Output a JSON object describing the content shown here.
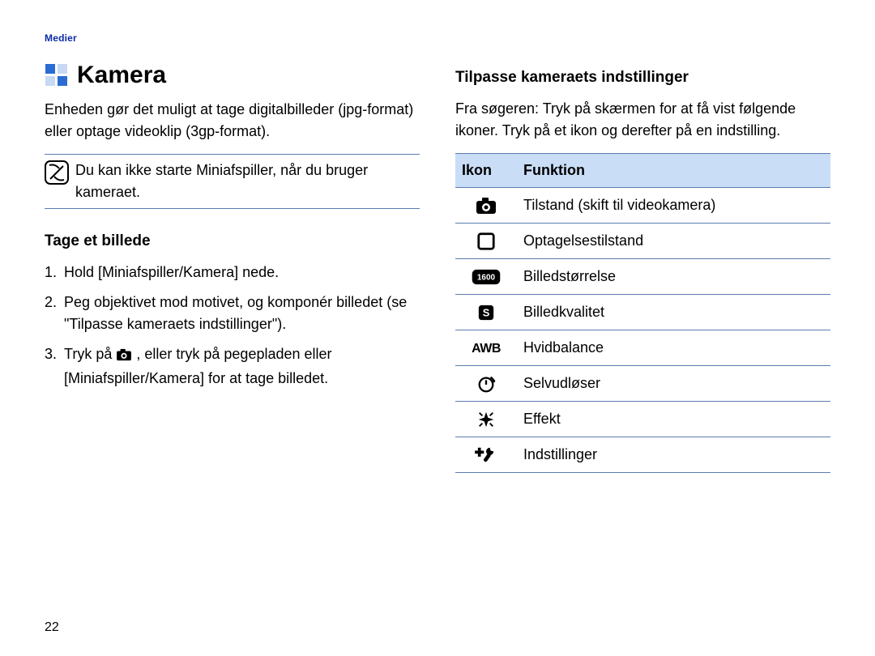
{
  "header": {
    "section": "Medier"
  },
  "page_number": "22",
  "h1": "Kamera",
  "intro": "Enheden gør det muligt at tage digitalbilleder (jpg-format) eller optage videoklip (3gp-format).",
  "note": "Du kan ikke starte Miniafspiller, når du bruger kameraet.",
  "h2_left": "Tage et billede",
  "steps": {
    "s1": "Hold [Miniafspiller/Kamera] nede.",
    "s2": "Peg objektivet mod motivet, og komponér billedet (se \"Tilpasse kameraets indstillinger\").",
    "s3a": "Tryk på ",
    "s3b": ", eller tryk på pegepladen eller [Miniafspiller/Kamera] for at tage billedet."
  },
  "h2_right": "Tilpasse kameraets indstillinger",
  "right_intro": "Fra søgeren: Tryk på skærmen for at få vist følgende ikoner. Tryk på et ikon og derefter på en indstilling.",
  "table": {
    "head_icon": "Ikon",
    "head_func": "Funktion",
    "rows": {
      "r1": "Tilstand (skift til videokamera)",
      "r2": "Optagelsestilstand",
      "r3": "Billedstørrelse",
      "r4": "Billedkvalitet",
      "r5": "Hvidbalance",
      "r6": "Selvudløser",
      "r7": "Effekt",
      "r8": "Indstillinger"
    }
  }
}
